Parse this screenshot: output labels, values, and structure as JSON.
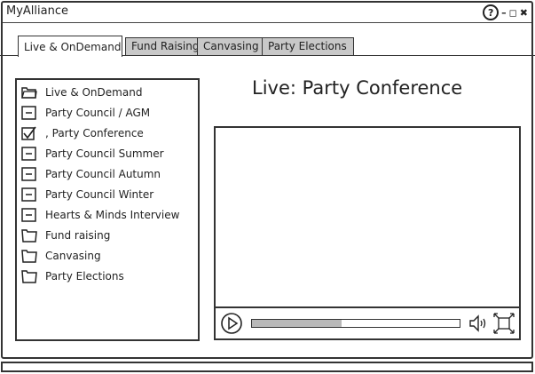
{
  "window": {
    "title": "MyAlliance"
  },
  "window_controls": [
    "?",
    "–",
    "◻",
    "✖"
  ],
  "tabs": [
    {
      "label": "Live & OnDemand",
      "active": true
    },
    {
      "label": "Fund Raising",
      "active": false
    },
    {
      "label": "Canvasing",
      "active": false
    },
    {
      "label": "Party Elections",
      "active": false
    }
  ],
  "tree": {
    "items": [
      {
        "label": "Live & OnDemand",
        "icon": "folder-open-icon"
      },
      {
        "label": "Party Council / AGM",
        "icon": "collapse-icon"
      },
      {
        "label": ", Party Conference",
        "icon": "checkbox-checked-icon"
      },
      {
        "label": "Party Council Summer",
        "icon": "collapse-icon"
      },
      {
        "label": "Party Council Autumn",
        "icon": "collapse-icon"
      },
      {
        "label": "Party Council Winter",
        "icon": "collapse-icon"
      },
      {
        "label": "Hearts & Minds Interview",
        "icon": "collapse-icon"
      },
      {
        "label": "Fund raising",
        "icon": "folder-icon"
      },
      {
        "label": "Canvasing",
        "icon": "folder-icon"
      },
      {
        "label": "Party Elections",
        "icon": "folder-icon"
      }
    ]
  },
  "main": {
    "title": "Live: Party Conference"
  },
  "player": {
    "progress": 0.43
  }
}
